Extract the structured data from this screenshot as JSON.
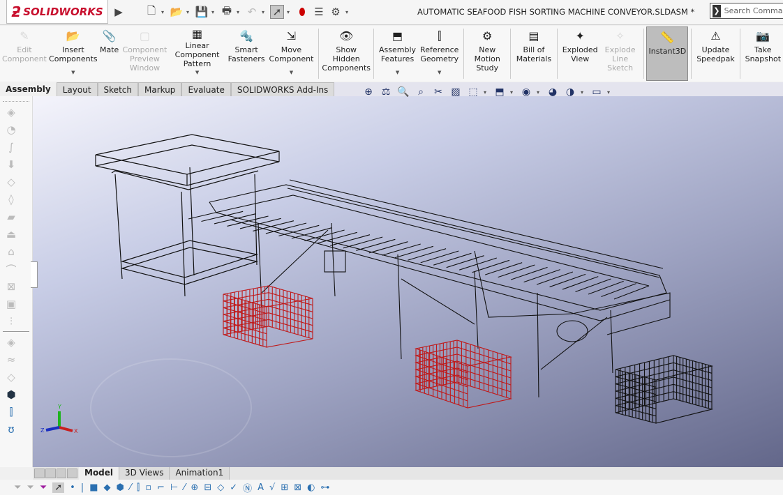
{
  "app": {
    "brand": "SOLIDWORKS",
    "document_title": "AUTOMATIC SEAFOOD FISH SORTING MACHINE CONVEYOR.SLDASM *",
    "search_placeholder": "Search Commar"
  },
  "quick_access": [
    {
      "icon": "new-document-icon"
    },
    {
      "icon": "open-folder-icon"
    },
    {
      "icon": "save-icon"
    },
    {
      "icon": "print-icon"
    },
    {
      "icon": "undo-icon"
    },
    {
      "icon": "select-cursor-icon"
    },
    {
      "icon": "rebuild-traffic-light-icon"
    },
    {
      "icon": "file-properties-icon"
    },
    {
      "icon": "options-gear-icon"
    }
  ],
  "ribbon": [
    {
      "label": "Edit Component",
      "icon": "edit-component-icon",
      "disabled": true
    },
    {
      "label": "Insert Components",
      "icon": "insert-components-icon",
      "dropdown": true
    },
    {
      "label": "Mate",
      "icon": "paperclip-icon"
    },
    {
      "label": "Component Preview Window",
      "icon": "preview-window-icon",
      "disabled": true
    },
    {
      "label": "Linear Component Pattern",
      "icon": "linear-pattern-icon",
      "dropdown": true
    },
    {
      "label": "Smart Fasteners",
      "icon": "smart-fasteners-icon"
    },
    {
      "label": "Move Component",
      "icon": "move-component-icon",
      "dropdown": true
    },
    {
      "label": "Show Hidden Components",
      "icon": "show-hidden-icon"
    },
    {
      "label": "Assembly Features",
      "icon": "assembly-features-icon",
      "dropdown": true
    },
    {
      "label": "Reference Geometry",
      "icon": "reference-geometry-icon",
      "dropdown": true
    },
    {
      "label": "New Motion Study",
      "icon": "motion-study-icon"
    },
    {
      "label": "Bill of Materials",
      "icon": "bom-icon"
    },
    {
      "label": "Exploded View",
      "icon": "exploded-view-icon"
    },
    {
      "label": "Explode Line Sketch",
      "icon": "explode-line-icon",
      "disabled": true
    },
    {
      "label": "Instant3D",
      "icon": "instant3d-icon",
      "active": true
    },
    {
      "label": "Update Speedpak",
      "icon": "speedpak-icon"
    },
    {
      "label": "Take Snapshot",
      "icon": "camera-icon"
    }
  ],
  "tabs": [
    {
      "label": "Assembly",
      "active": true
    },
    {
      "label": "Layout"
    },
    {
      "label": "Sketch"
    },
    {
      "label": "Markup"
    },
    {
      "label": "Evaluate"
    },
    {
      "label": "SOLIDWORKS Add-Ins"
    }
  ],
  "bottom_tabs": [
    {
      "label": "Model",
      "active": true
    },
    {
      "label": "3D Views"
    },
    {
      "label": "Animation1"
    }
  ],
  "triad": {
    "x": "X",
    "y": "Y",
    "z": "Z"
  },
  "colors": {
    "crate_red": "#c01818",
    "crate_black": "#111111",
    "brand_red": "#c8102e"
  }
}
